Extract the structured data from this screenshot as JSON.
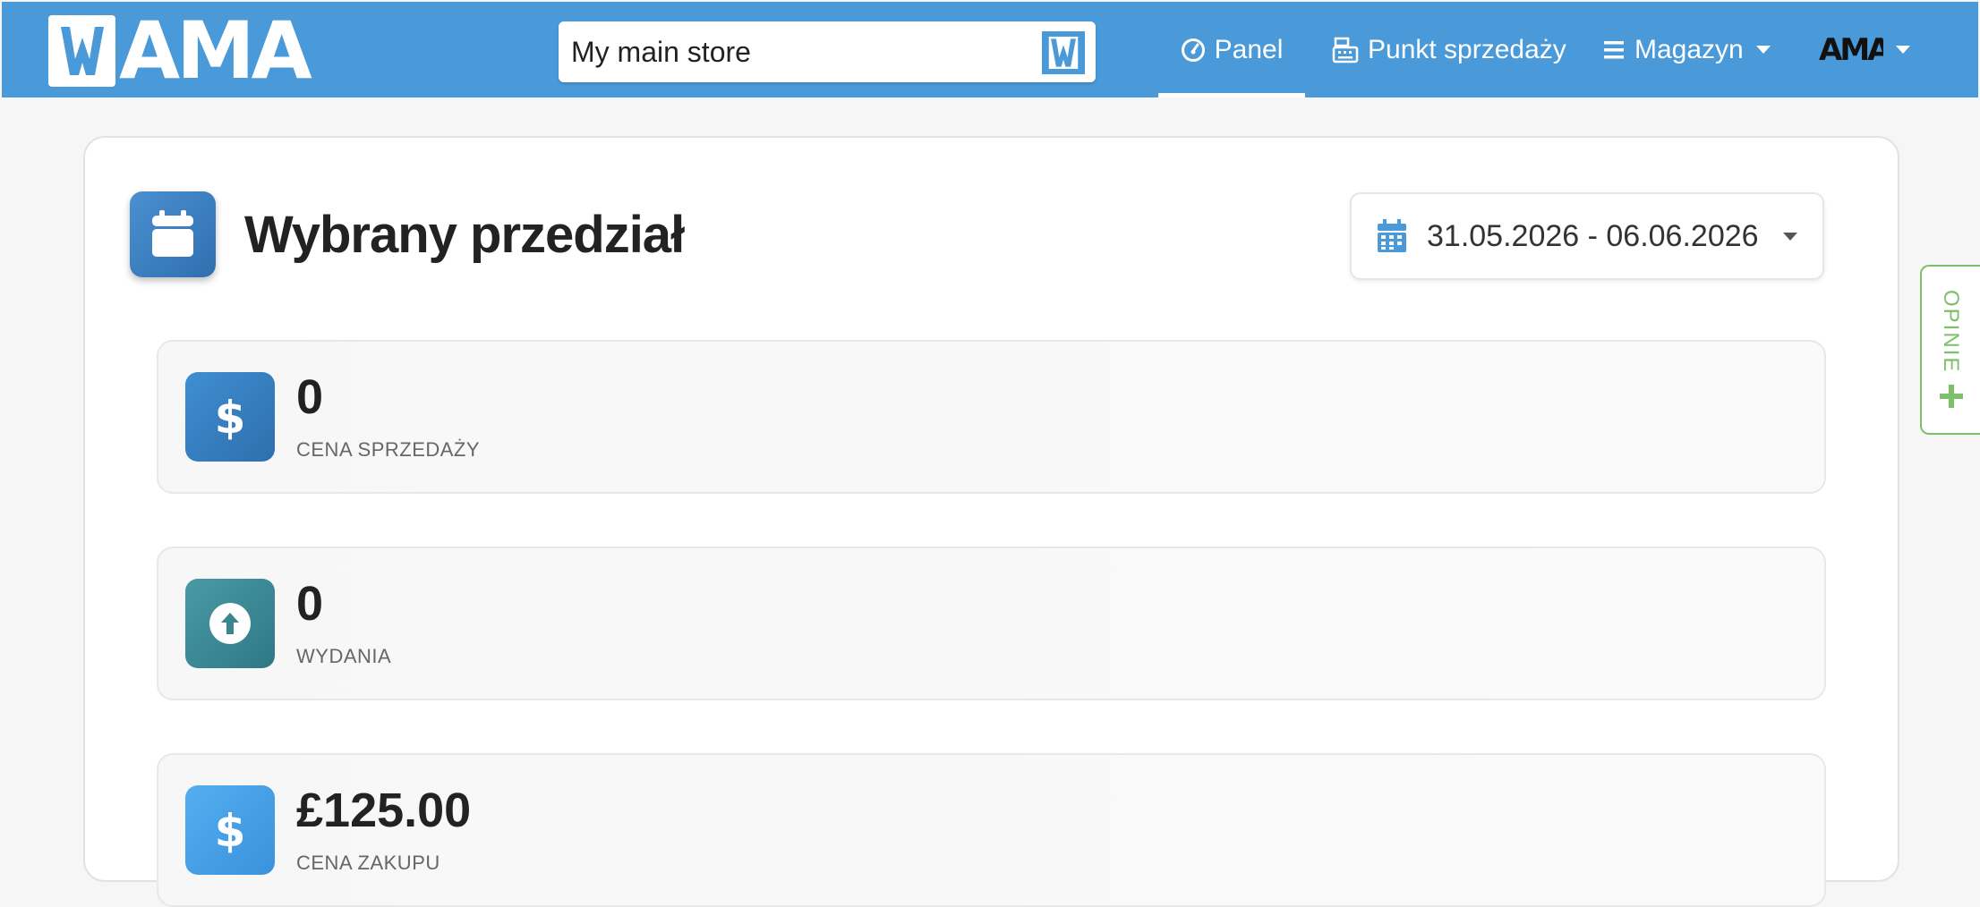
{
  "navbar": {
    "logo_text": "AMA",
    "store_name": "My main store",
    "items": [
      {
        "label": "Panel",
        "icon": "dashboard-gauge-icon",
        "active": true
      },
      {
        "label": "Punkt sprzedaży",
        "icon": "cash-register-icon"
      },
      {
        "label": "Magazyn",
        "icon": "list-bars-icon"
      }
    ],
    "account_logo_text": "AMA",
    "colors": {
      "bar": "#4a9ad9",
      "accent": "#4a9ad9"
    }
  },
  "main": {
    "title": "Wybrany przedział",
    "title_icon": "calendar-icon",
    "date_range": "31.05.2026 - 06.06.2026",
    "stats": [
      {
        "value": "0",
        "label": "CENA SPRZEDAŻY",
        "icon": "dollar-icon",
        "color": "#3a86c8"
      },
      {
        "value": "0",
        "label": "WYDANIA",
        "icon": "arrow-up-circle-icon",
        "color": "#3e8d96"
      },
      {
        "value": "£125.00",
        "label": "CENA ZAKUPU",
        "icon": "dollar-icon",
        "color": "#4aa2e6"
      }
    ]
  },
  "feedback_tab": {
    "label": "OPINIE",
    "icon": "plus-icon",
    "color": "#7cc06a"
  }
}
